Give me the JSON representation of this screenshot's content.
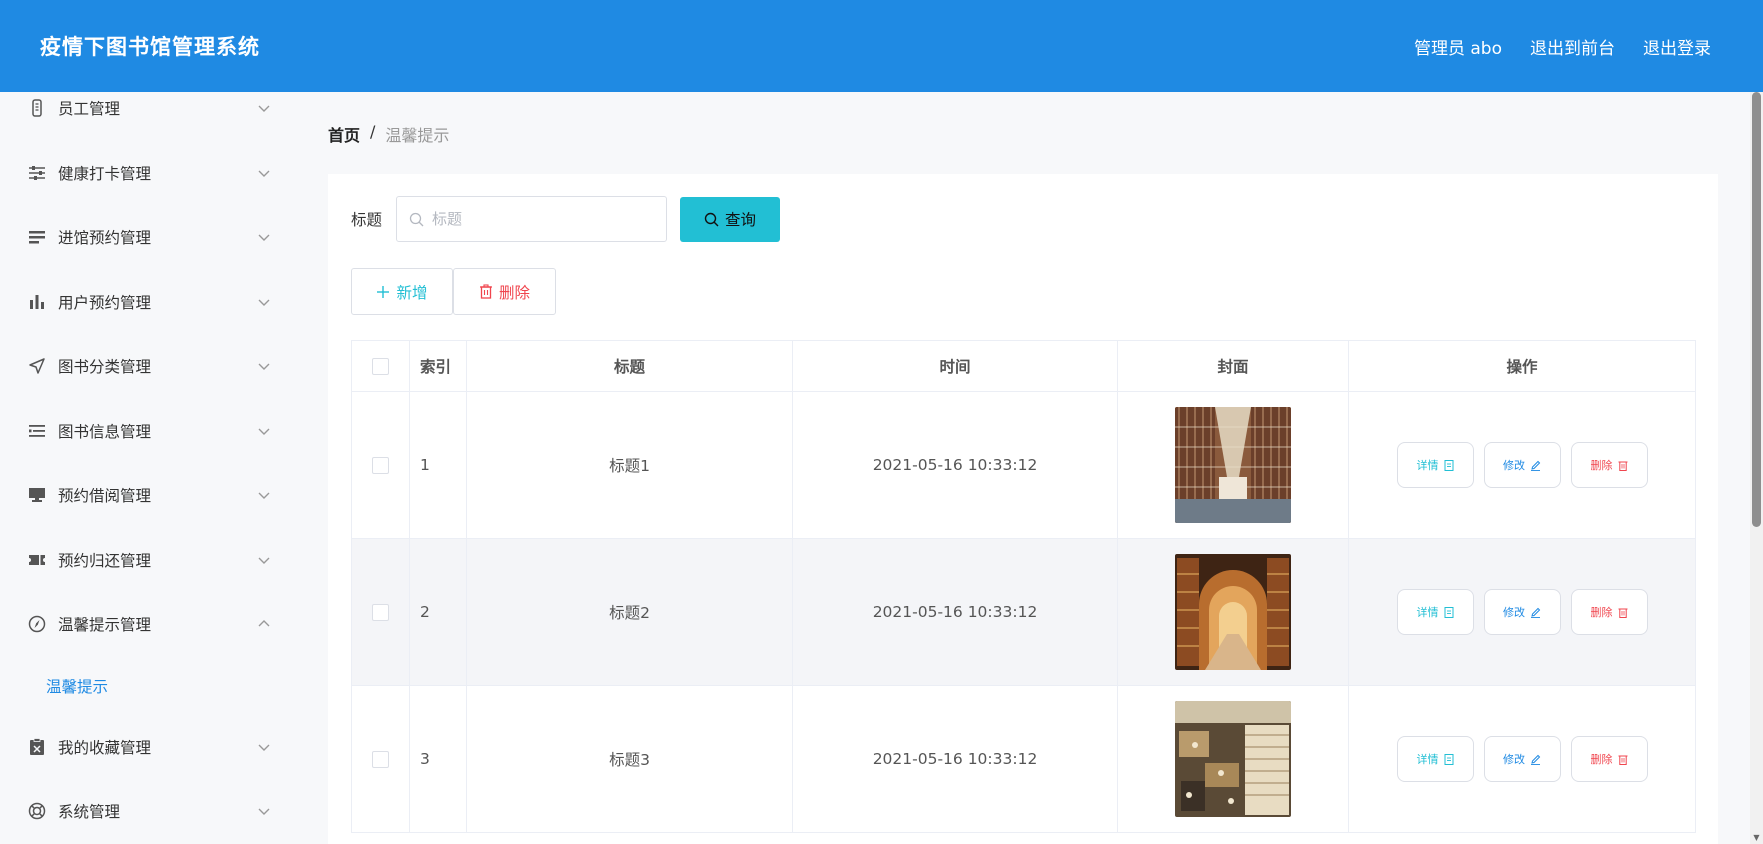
{
  "header": {
    "title": "疫情下图书馆管理系统",
    "actions": [
      "管理员 abo",
      "退出到前台",
      "退出登录"
    ]
  },
  "sidebar": {
    "items": [
      {
        "label": "员工管理",
        "icon": "id-badge-icon",
        "expanded": false
      },
      {
        "label": "健康打卡管理",
        "icon": "sliders-icon",
        "expanded": false
      },
      {
        "label": "进馆预约管理",
        "icon": "list-icon",
        "expanded": false
      },
      {
        "label": "用户预约管理",
        "icon": "bar-chart-icon",
        "expanded": false
      },
      {
        "label": "图书分类管理",
        "icon": "navigation-icon",
        "expanded": false
      },
      {
        "label": "图书信息管理",
        "icon": "list-lines-icon",
        "expanded": false
      },
      {
        "label": "预约借阅管理",
        "icon": "monitor-icon",
        "expanded": false
      },
      {
        "label": "预约归还管理",
        "icon": "ticket-icon",
        "expanded": false
      },
      {
        "label": "温馨提示管理",
        "icon": "compass-icon",
        "expanded": true
      },
      {
        "label": "我的收藏管理",
        "icon": "clipboard-x-icon",
        "expanded": false
      },
      {
        "label": "系统管理",
        "icon": "lifebuoy-icon",
        "expanded": false
      }
    ],
    "submenu": {
      "label": "温馨提示",
      "active": true
    }
  },
  "breadcrumb": {
    "home": "首页",
    "separator": "/",
    "current": "温馨提示"
  },
  "search": {
    "label": "标题",
    "placeholder": "标题",
    "value": "",
    "button_label": "查询"
  },
  "toolbar": {
    "add_label": "新增",
    "delete_label": "删除"
  },
  "table": {
    "columns": [
      "索引",
      "标题",
      "时间",
      "封面",
      "操作"
    ],
    "rows": [
      {
        "index": "1",
        "title": "标题1",
        "time": "2021-05-16 10:33:12",
        "cover": "library-hall-photo"
      },
      {
        "index": "2",
        "title": "标题2",
        "time": "2021-05-16 10:33:12",
        "cover": "library-arch-photo"
      },
      {
        "index": "3",
        "title": "标题3",
        "time": "2021-05-16 10:33:12",
        "cover": "bookstore-photo"
      }
    ],
    "row_actions": {
      "detail": "详情",
      "edit": "修改",
      "delete": "删除"
    }
  },
  "colors": {
    "header_bg": "#1f8ae3",
    "accent_cyan": "#22bfd4",
    "danger": "#f0454e",
    "link_blue": "#1f8ae3"
  }
}
